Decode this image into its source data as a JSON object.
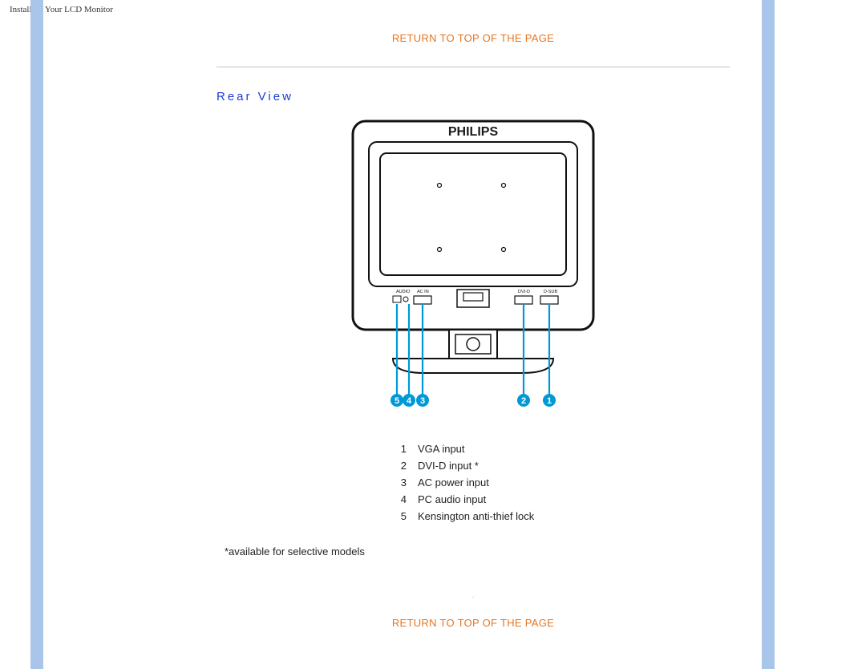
{
  "header": {
    "title": "Installing Your LCD Monitor"
  },
  "links": {
    "return_top_1": "RETURN TO TOP OF THE PAGE",
    "return_top_2": "RETURN TO TOP OF THE PAGE"
  },
  "section": {
    "title": "Rear View"
  },
  "diagram": {
    "brand": "PHILIPS",
    "port_labels": [
      "AUDIO",
      "AC IN",
      "DVI-D",
      "D-SUB"
    ],
    "callouts": [
      {
        "num": "5"
      },
      {
        "num": "4"
      },
      {
        "num": "3"
      },
      {
        "num": "2"
      },
      {
        "num": "1"
      }
    ]
  },
  "legend": [
    {
      "num": "1",
      "label": "VGA input"
    },
    {
      "num": "2",
      "label": "DVI-D input *"
    },
    {
      "num": "3",
      "label": "AC power input"
    },
    {
      "num": "4",
      "label": "PC audio input"
    },
    {
      "num": "5",
      "label": "Kensington anti-thief lock"
    }
  ],
  "footnote": "*available for selective models"
}
